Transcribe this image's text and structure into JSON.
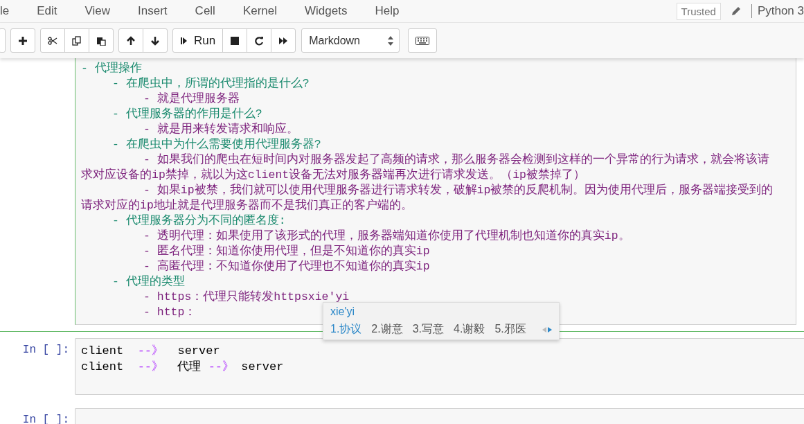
{
  "menubar": {
    "items": [
      "le",
      "Edit",
      "View",
      "Insert",
      "Cell",
      "Kernel",
      "Widgets",
      "Help"
    ],
    "trusted": "Trusted",
    "kernel": "Python 3"
  },
  "toolbar": {
    "groups": [
      [
        {
          "kind": "partial"
        }
      ],
      [
        {
          "kind": "add"
        }
      ],
      [
        {
          "kind": "cut"
        },
        {
          "kind": "copy"
        },
        {
          "kind": "paste"
        }
      ],
      [
        {
          "kind": "up"
        },
        {
          "kind": "down"
        }
      ],
      [
        {
          "kind": "run",
          "label": "Run"
        },
        {
          "kind": "stop"
        },
        {
          "kind": "restart"
        },
        {
          "kind": "fastforward"
        }
      ]
    ],
    "cell_type": "Markdown"
  },
  "cells": [
    {
      "kind": "markdown",
      "selected": true,
      "lines": [
        {
          "text": "- 代理操作",
          "kind": "topic",
          "children": [
            {
              "text": "- 在爬虫中，所谓的代理指的是什么?",
              "kind": "topic",
              "children": [
                {
                  "text": "- 就是代理服务器",
                  "kind": "detail"
                }
              ]
            },
            {
              "text": "- 代理服务器的作用是什么?",
              "kind": "topic",
              "children": [
                {
                  "text": "- 就是用来转发请求和响应。",
                  "kind": "detail"
                }
              ]
            },
            {
              "text": "- 在爬虫中为什么需要使用代理服务器?",
              "kind": "topic",
              "children": [
                {
                  "text": "- 如果我们的爬虫在短时间内对服务器发起了高频的请求，那么服务器会检测到这样的一个异常的行为请求，就会将该请求对应设备的ip禁掉，就以为这client设备无法对服务器端再次进行请求发送。（ip被禁掉了）",
                  "kind": "detail"
                },
                {
                  "text": "- 如果ip被禁，我们就可以使用代理服务器进行请求转发，破解ip被禁的反爬机制。因为使用代理后，服务器端接受到的请求对应的ip地址就是代理服务器而不是我们真正的客户端的。",
                  "kind": "detail"
                }
              ]
            },
            {
              "text": "- 代理服务器分为不同的匿名度:",
              "kind": "topic",
              "children": [
                {
                  "text": "- 透明代理：如果使用了该形式的代理，服务器端知道你使用了代理机制也知道你的真实ip。",
                  "kind": "detail"
                },
                {
                  "text": "- 匿名代理：知道你使用代理，但是不知道你的真实ip",
                  "kind": "detail"
                },
                {
                  "text": "- 高匿代理：不知道你使用了代理也不知道你的真实ip",
                  "kind": "detail"
                }
              ]
            },
            {
              "text": "- 代理的类型",
              "kind": "topic",
              "children": [
                {
                  "text": "- https：代理只能转发httpsxie'yi",
                  "kind": "detail"
                },
                {
                  "text": "- http：",
                  "kind": "detail"
                }
              ]
            }
          ]
        }
      ]
    },
    {
      "kind": "code",
      "selected": false,
      "prompt": "In [ ]:",
      "lines": [
        [
          {
            "text": "client  ",
            "kind": "plain"
          },
          {
            "text": "--》",
            "kind": "operator"
          },
          {
            "text": "  server",
            "kind": "plain"
          }
        ],
        [
          {
            "text": "client  ",
            "kind": "plain"
          },
          {
            "text": "--》",
            "kind": "operator"
          },
          {
            "text": "  代理 ",
            "kind": "plain"
          },
          {
            "text": "--》",
            "kind": "operator"
          },
          {
            "text": " server",
            "kind": "plain"
          }
        ]
      ]
    },
    {
      "kind": "code",
      "selected": false,
      "prompt": "In [ ]:"
    }
  ],
  "ime": {
    "input": "xie'yi",
    "candidates": [
      {
        "text": "1.协议",
        "selected": true
      },
      {
        "text": "2.谢意",
        "selected": false
      },
      {
        "text": "3.写意",
        "selected": false
      },
      {
        "text": "4.谢毅",
        "selected": false
      },
      {
        "text": "5.邪医",
        "selected": false
      }
    ]
  }
}
